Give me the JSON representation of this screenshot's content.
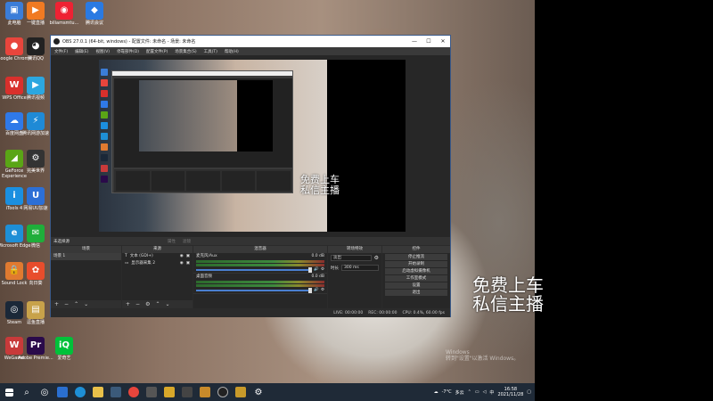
{
  "desktop_icons": [
    {
      "label": "此电脑",
      "icon": "computer-icon",
      "color": "#3b7dd8",
      "glyph": "▣"
    },
    {
      "label": "一键直播",
      "icon": "broadcast-icon",
      "color": "#f07a22",
      "glyph": "▶"
    },
    {
      "label": "biliamsmtu...",
      "icon": "bilibili-icon",
      "color": "#e23",
      "glyph": "◉"
    },
    {
      "label": "腾讯会议",
      "icon": "meeting-icon",
      "color": "#2a7ae2",
      "glyph": "◆"
    },
    {
      "label": "Google Chrome",
      "icon": "chrome-icon",
      "color": "#e8453c",
      "glyph": "●"
    },
    {
      "label": "腾讯QQ",
      "icon": "qq-icon",
      "color": "#222",
      "glyph": "◕"
    },
    {
      "label": "WPS Office",
      "icon": "wps-icon",
      "color": "#d9302c",
      "glyph": "W"
    },
    {
      "label": "腾讯视频",
      "icon": "video-icon",
      "color": "#2ca7e0",
      "glyph": "▶"
    },
    {
      "label": "百度网盘",
      "icon": "cloud-icon",
      "color": "#2f79e8",
      "glyph": "☁"
    },
    {
      "label": "腾讯网游加速",
      "icon": "accelerator-icon",
      "color": "#1f8ad6",
      "glyph": "⚡"
    },
    {
      "label": "GeForce Experience",
      "icon": "nvidia-icon",
      "color": "#5aa516",
      "glyph": "◢"
    },
    {
      "label": "完美世界",
      "icon": "game-icon",
      "color": "#333",
      "glyph": "⚙"
    },
    {
      "label": "iTools 4",
      "icon": "itools-icon",
      "color": "#1b8fe0",
      "glyph": "i"
    },
    {
      "label": "网易UU加速",
      "icon": "uu-icon",
      "color": "#2c6fd6",
      "glyph": "U"
    },
    {
      "label": "Microsoft Edge",
      "icon": "edge-icon",
      "color": "#1e8fd6",
      "glyph": "e"
    },
    {
      "label": "微信",
      "icon": "wechat-icon",
      "color": "#1fae3a",
      "glyph": "✉"
    },
    {
      "label": "Sound Lock",
      "icon": "lock-icon",
      "color": "#e07a30",
      "glyph": "🔒"
    },
    {
      "label": "向日葵",
      "icon": "sunflower-icon",
      "color": "#e84d2c",
      "glyph": "✿"
    },
    {
      "label": "Steam",
      "icon": "steam-icon",
      "color": "#1b2838",
      "glyph": "◎"
    },
    {
      "label": "逗鱼直播",
      "icon": "folder-icon",
      "color": "#c8a24a",
      "glyph": "▤"
    },
    {
      "label": "WeGame",
      "icon": "wegame-icon",
      "color": "#c83a3a",
      "glyph": "W"
    },
    {
      "label": "Adobe Premie...",
      "icon": "premiere-icon",
      "color": "#2a0a4a",
      "glyph": "Pr"
    },
    {
      "label": "爱奇艺",
      "icon": "iqiyi-icon",
      "color": "#00c13a",
      "glyph": "iQ"
    }
  ],
  "overlay": {
    "big": "免费上车\n私信主播",
    "small": "免费上车\n私信主播"
  },
  "watermark": {
    "line1": "Windows",
    "line2": "转到\"设置\"以激活 Windows。"
  },
  "obs": {
    "title": "OBS 27.0.1 (64-bit, windows) - 配置文件: 未命名 - 场景: 未命名",
    "controls": {
      "min": "—",
      "max": "☐",
      "close": "✕"
    },
    "menu": [
      "文件(F)",
      "编辑(E)",
      "视图(V)",
      "停靠部件(D)",
      "配置文件(P)",
      "场景集合(S)",
      "工具(T)",
      "帮助(H)"
    ],
    "source_bar": {
      "label": "未选择源",
      "props": "属性",
      "filters": "滤镜"
    },
    "docks": {
      "scenes": {
        "header": "场景",
        "items": [
          "场景 1"
        ]
      },
      "sources": {
        "header": "来源",
        "items": [
          "文本 (GDI+)",
          "显示器采集 2"
        ]
      },
      "mixer": {
        "header": "混音器",
        "channels": [
          {
            "name": "麦克风/Aux",
            "db": "0.0 dB"
          },
          {
            "name": "桌面音频",
            "db": "0.0 dB"
          }
        ]
      },
      "transitions": {
        "header": "转场特效",
        "type": "淡出",
        "duration_label": "时长",
        "duration": "300 ms"
      },
      "controls": {
        "header": "控件",
        "buttons": [
          "停止推流",
          "开始录制",
          "启动虚拟摄像机",
          "工作室模式",
          "设置",
          "退出"
        ]
      }
    },
    "status": {
      "live": "LIVE: 00:00:00",
      "rec": "REC: 00:00:00",
      "cpu": "CPU: 0.4%, 60.00 fps"
    }
  },
  "taskbar": {
    "temp": "-7°C",
    "weather": "多云",
    "time": "16:58",
    "date": "2021/11/28"
  }
}
